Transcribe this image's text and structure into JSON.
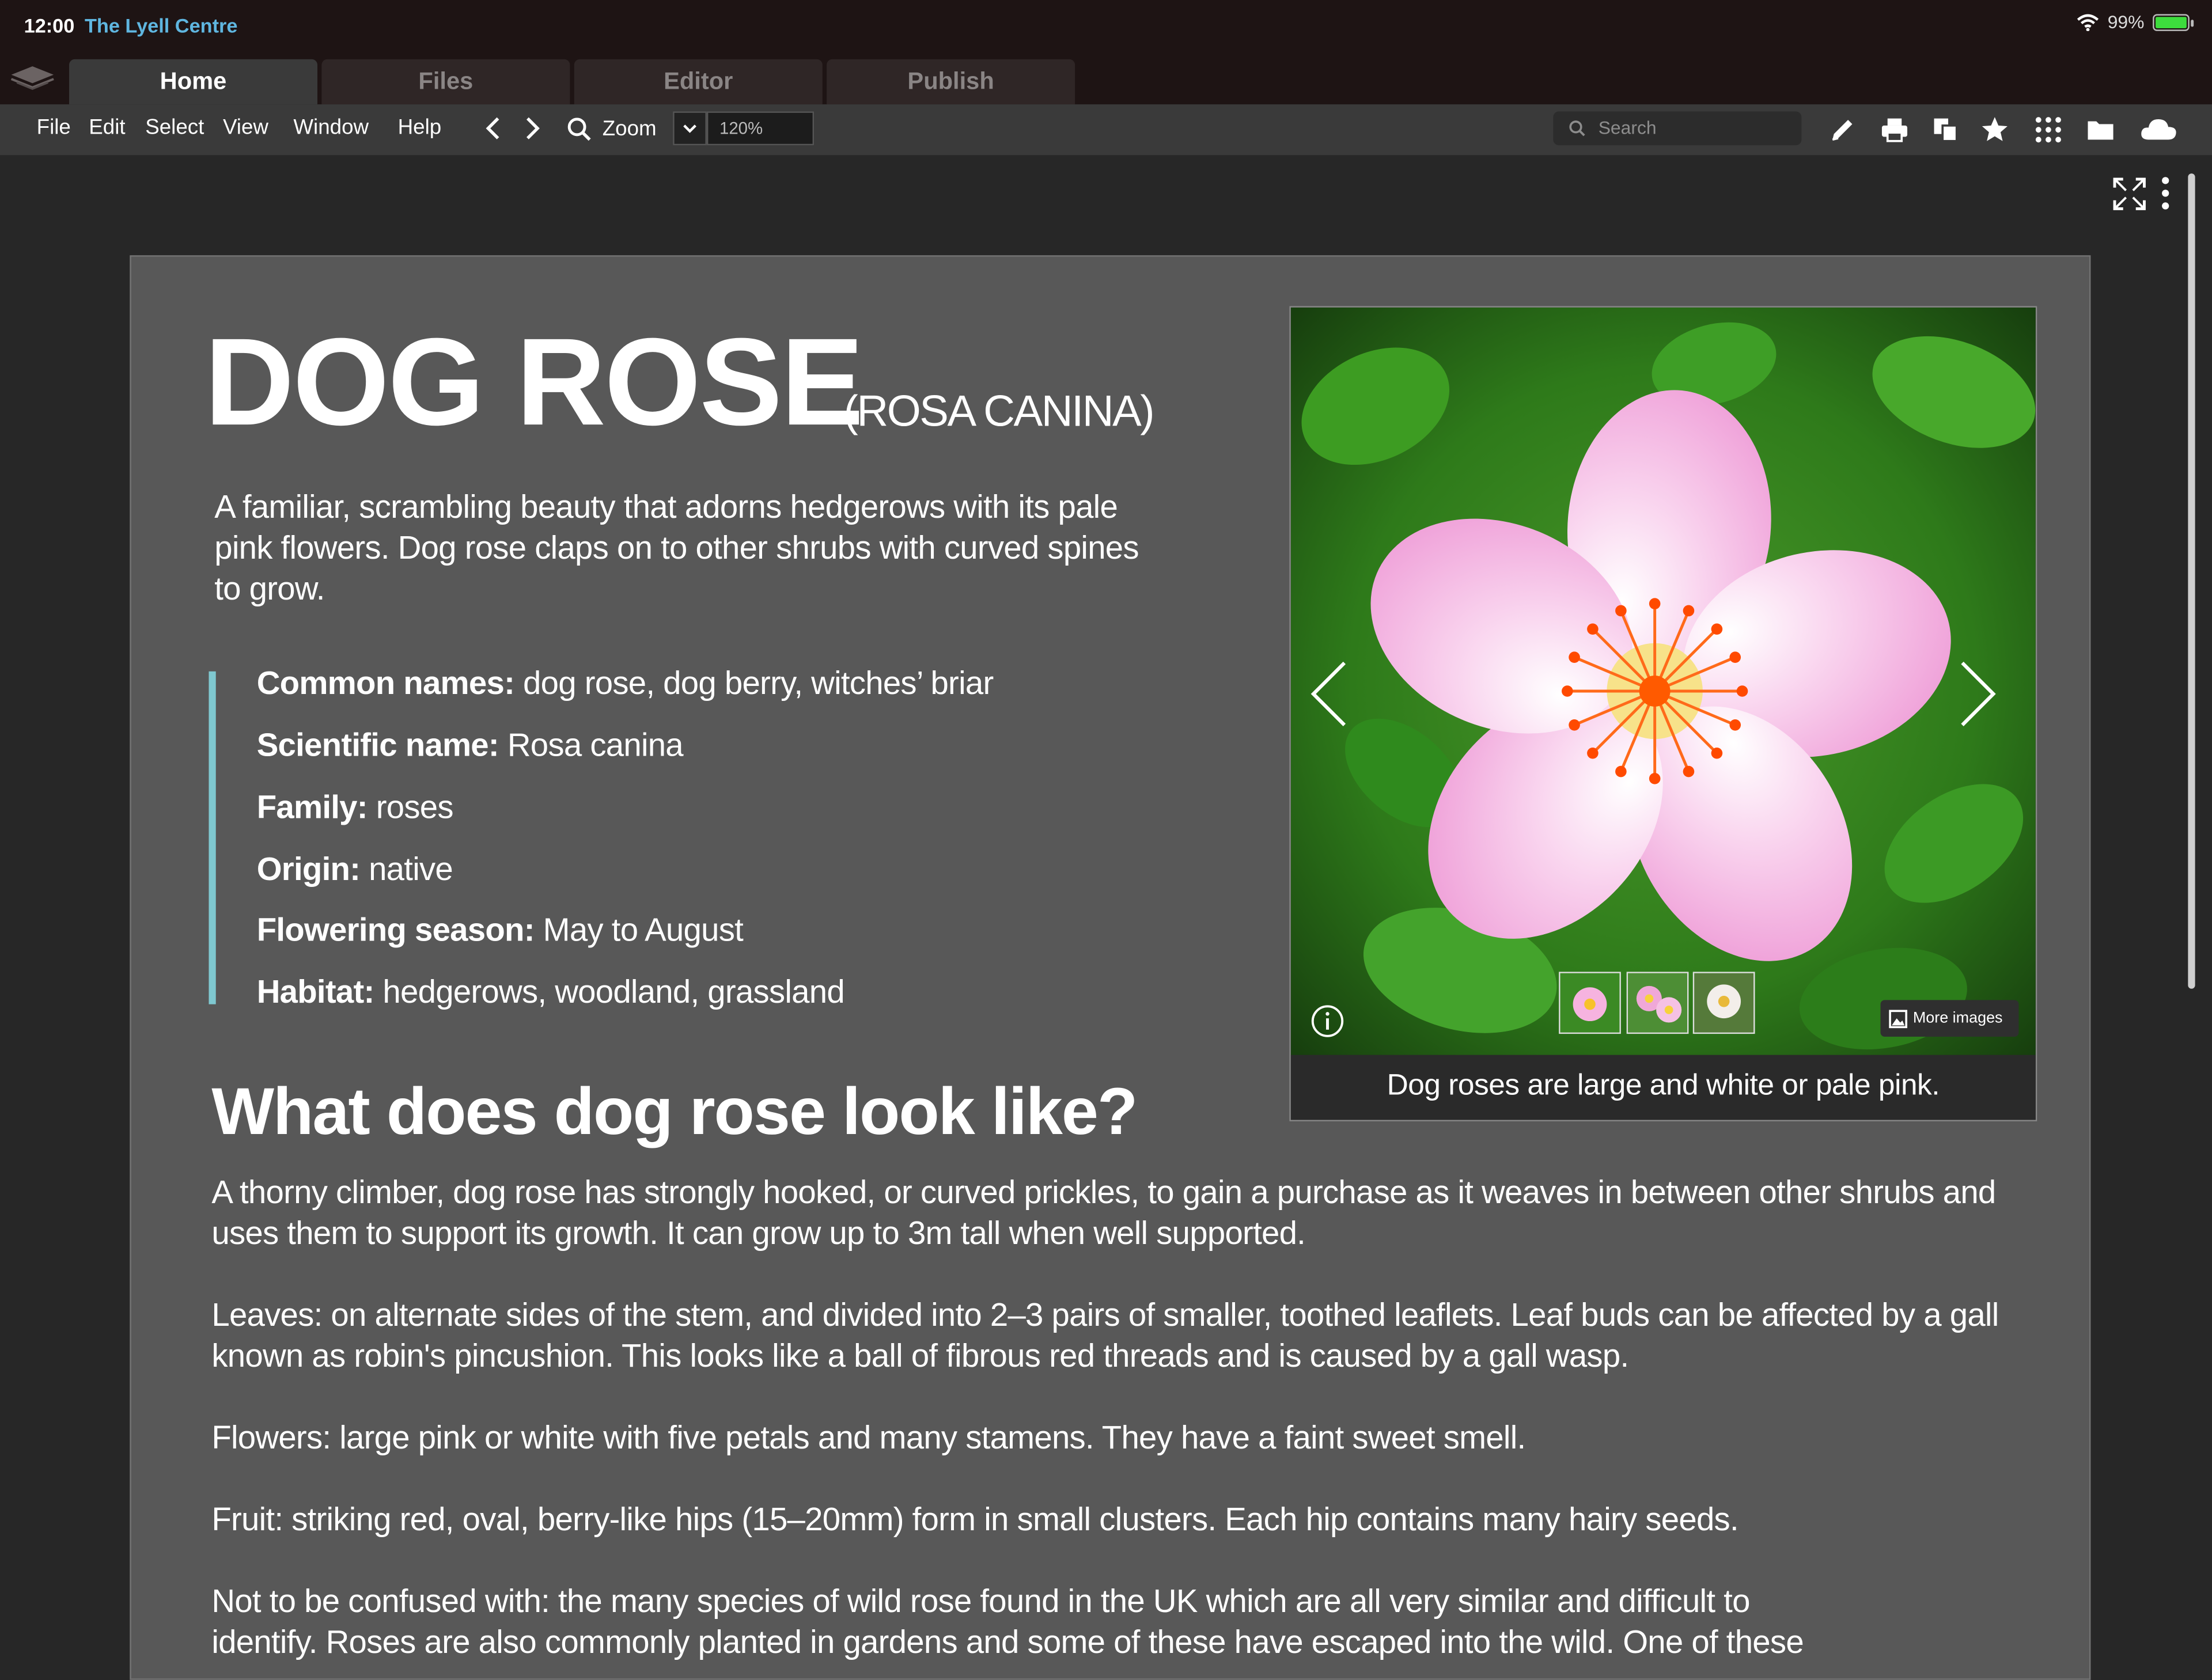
{
  "status": {
    "time": "12:00",
    "app_name": "The Lyell Centre",
    "battery": "99%",
    "battery_level": 0.99
  },
  "tabs": [
    {
      "label": "Home",
      "active": true
    },
    {
      "label": "Files",
      "active": false
    },
    {
      "label": "Editor",
      "active": false
    },
    {
      "label": "Publish",
      "active": false
    }
  ],
  "menu": [
    "File",
    "Edit",
    "Select",
    "View",
    "Window",
    "Help"
  ],
  "toolbar": {
    "zoom_label": "Zoom",
    "zoom_value": "120%",
    "search_placeholder": "Search"
  },
  "article": {
    "title": "DOG ROSE",
    "subtitle": "(ROSA CANINA)",
    "intro": "A familiar, scrambling beauty that adorns hedgerows with its pale pink flowers. Dog rose claps on to other shrubs with curved spines to grow.",
    "facts": [
      {
        "label": "Common names:",
        "value": " dog rose, dog berry, witches’ briar"
      },
      {
        "label": "Scientific name:",
        "value": " Rosa canina"
      },
      {
        "label": "Family:",
        "value": " roses"
      },
      {
        "label": "Origin:",
        "value": " native"
      },
      {
        "label": "Flowering season:",
        "value": " May to August"
      },
      {
        "label": "Habitat:",
        "value": " hedgerows, woodland, grassland"
      }
    ],
    "heading": "What does dog rose look like?",
    "paragraphs": [
      "A thorny climber, dog rose has strongly hooked, or curved prickles, to gain a purchase as it weaves in between other shrubs and uses them to support its growth. It can grow up to 3m tall when well supported.",
      "Leaves: on alternate sides of the stem, and divided into 2–3 pairs of smaller, toothed leaflets. Leaf buds can be affected by a gall known as robin's pincushion. This looks like a ball of fibrous red threads and is caused by a gall wasp.",
      "Flowers: large pink or white with five petals and many stamens. They have a faint sweet smell.",
      "Fruit: striking red, oval, berry-like hips (15–20mm) form in small clusters. Each hip contains many hairy seeds.",
      "Not to be confused with: the many species of wild rose found in the UK which are all very similar and difficult to identify. Roses are also commonly planted in gardens and some of these have escaped into the wild. One of these"
    ]
  },
  "gallery": {
    "caption": "Dog roses are large and white or pale pink.",
    "more_images": "More images",
    "thumbnail_count": 3
  },
  "colors": {
    "accent": "#7fc8d0",
    "link": "#5fb6e0",
    "page": "#585858",
    "chrome": "#1e1414"
  }
}
